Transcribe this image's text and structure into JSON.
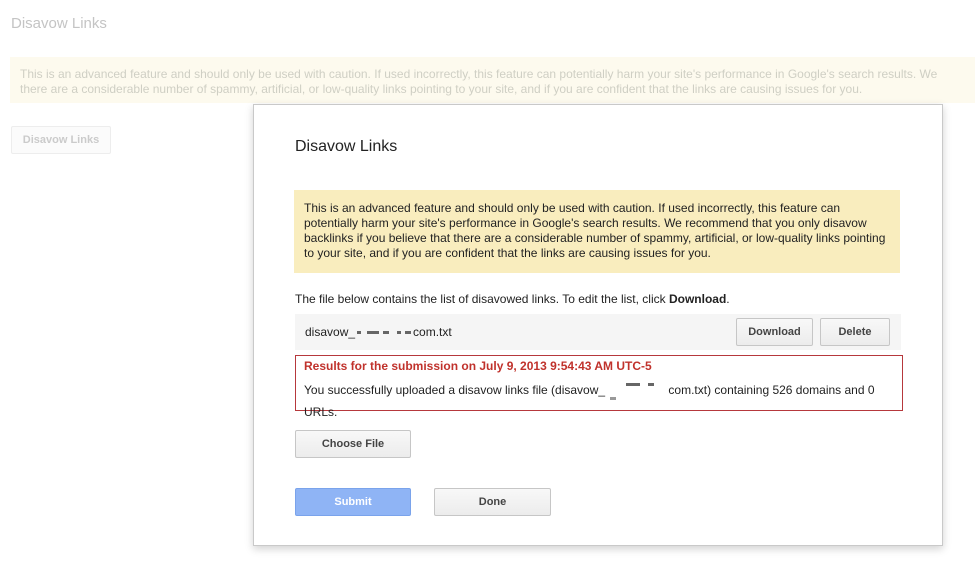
{
  "background": {
    "title": "Disavow Links",
    "warning_line1": "This is an advanced feature and should only be used with caution. If used incorrectly, this feature can potentially harm your site's performance in Google's search results. We",
    "warning_line2": "there are a considerable number of spammy, artificial, or low-quality links pointing to your site, and if you are confident that the links are causing issues for you.",
    "button_label": "Disavow Links"
  },
  "dialog": {
    "title": "Disavow Links",
    "warning": "This is an advanced feature and should only be used with caution. If used incorrectly, this feature can potentially harm your site's performance in Google's search results. We recommend that you only disavow backlinks if you believe that there are a considerable number of spammy, artificial, or low-quality links pointing to your site, and if you are confident that the links are causing issues for you.",
    "instructions_prefix": "The file below contains the list of disavowed links. To edit the list, click ",
    "instructions_bold": "Download",
    "instructions_suffix": ".",
    "file": {
      "name_prefix": "disavow_",
      "name_suffix": "com.txt",
      "download_label": "Download",
      "delete_label": "Delete"
    },
    "results": {
      "title": "Results for the submission on July 9, 2013 9:54:43 AM UTC-5",
      "message_prefix": "You successfully uploaded a disavow links file (disavow_",
      "message_suffix": "com.txt) containing 526 domains and 0 URLs."
    },
    "choose_file_label": "Choose File",
    "submit_label": "Submit",
    "done_label": "Done"
  },
  "colors": {
    "warning_bg": "#f9edbe",
    "error_border": "#b6383c",
    "error_text": "#c0322c",
    "submit_bg": "#8fb4f5"
  }
}
